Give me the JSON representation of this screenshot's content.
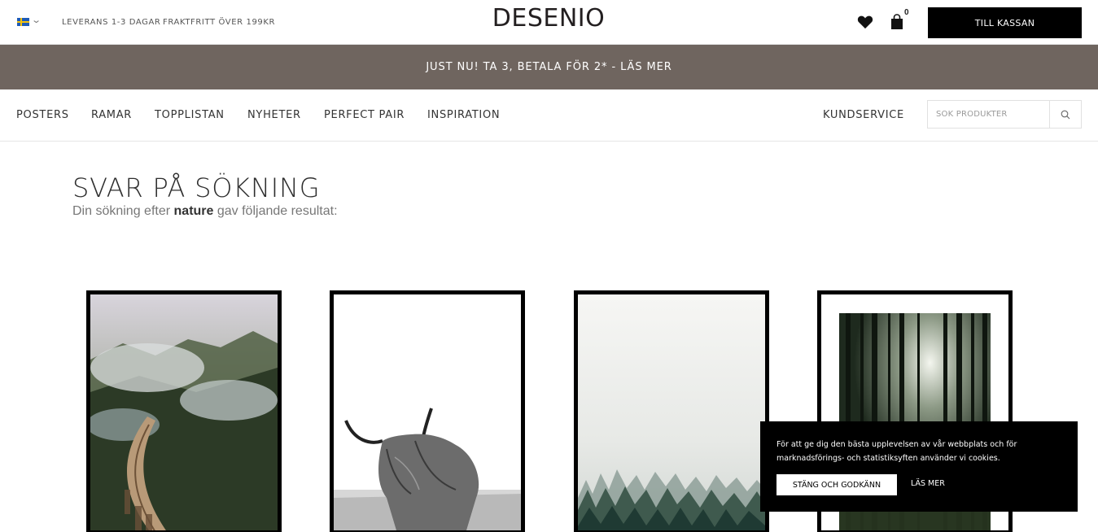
{
  "topbar": {
    "country_icon": "sweden-flag-icon",
    "delivery": "LEVERANS 1-3 DAGAR",
    "free_shipping": "FRAKTFRITT ÖVER 199KR",
    "logo": "DESENIO",
    "cart_count": "0",
    "checkout_label": "TILL KASSAN"
  },
  "promo": {
    "text": "JUST NU! TA 3, BETALA FÖR 2* - LÄS MER"
  },
  "nav": {
    "items": [
      "POSTERS",
      "RAMAR",
      "TOPPLISTAN",
      "NYHETER",
      "PERFECT PAIR",
      "INSPIRATION"
    ],
    "customer_service": "KUNDSERVICE",
    "search_placeholder": "SÖK PRODUKTER"
  },
  "results": {
    "title": "SVAR PÅ SÖKNING",
    "sub_prefix": "Din sökning efter ",
    "query": "nature",
    "sub_suffix": " gav följande resultat:"
  },
  "products": [
    {
      "image": "misty-railway-bridge-poster"
    },
    {
      "image": "highland-cow-poster"
    },
    {
      "image": "foggy-forest-poster"
    },
    {
      "image": "dark-forest-sunlight-poster"
    }
  ],
  "cookie": {
    "text": "För att ge dig den bästa upplevelsen av vår webbplats och för marknadsförings- och statistiksyften använder vi cookies.",
    "accept_label": "STÄNG OCH GODKÄNN",
    "more_label": "LÄS MER"
  },
  "colors": {
    "promo_bg": "#6f655f",
    "checkout_bg": "#000000",
    "cookie_bg": "#000000"
  }
}
